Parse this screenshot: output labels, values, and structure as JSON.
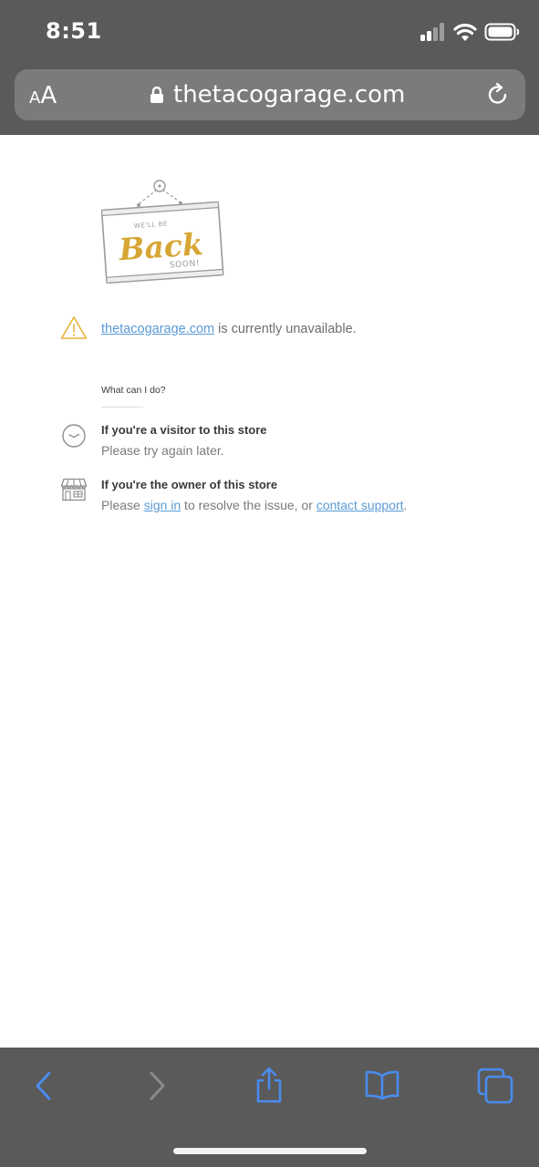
{
  "status_bar": {
    "time": "8:51"
  },
  "browser": {
    "text_size_small": "A",
    "text_size_large": "A",
    "url": "thetacogarage.com"
  },
  "page": {
    "sign": {
      "line1": "WE'LL BE",
      "line2": "Back",
      "line3": "SOON!"
    },
    "notice": {
      "domain_link": "thetacogarage.com",
      "message": " is currently unavailable."
    },
    "what_heading": "What can I do?",
    "visitor": {
      "title": "If you're a visitor to this store",
      "description": "Please try again later."
    },
    "owner": {
      "title": "If you're the owner of this store",
      "prefix": "Please ",
      "sign_in_link": "sign in",
      "middle": " to resolve the issue, or ",
      "support_link": "contact support",
      "suffix": "."
    }
  },
  "colors": {
    "chrome": "#5a5a5a",
    "address_bar": "#7b7b7b",
    "toolbar_icon": "#4a8cf0",
    "toolbar_icon_disabled": "#8a8a8a",
    "link": "#5b9bd5",
    "warning": "#e8b23a",
    "sign_gold": "#d7a634"
  },
  "toolbar": {
    "icons": [
      "back-icon",
      "forward-icon",
      "share-icon",
      "bookmarks-icon",
      "tabs-icon"
    ]
  }
}
